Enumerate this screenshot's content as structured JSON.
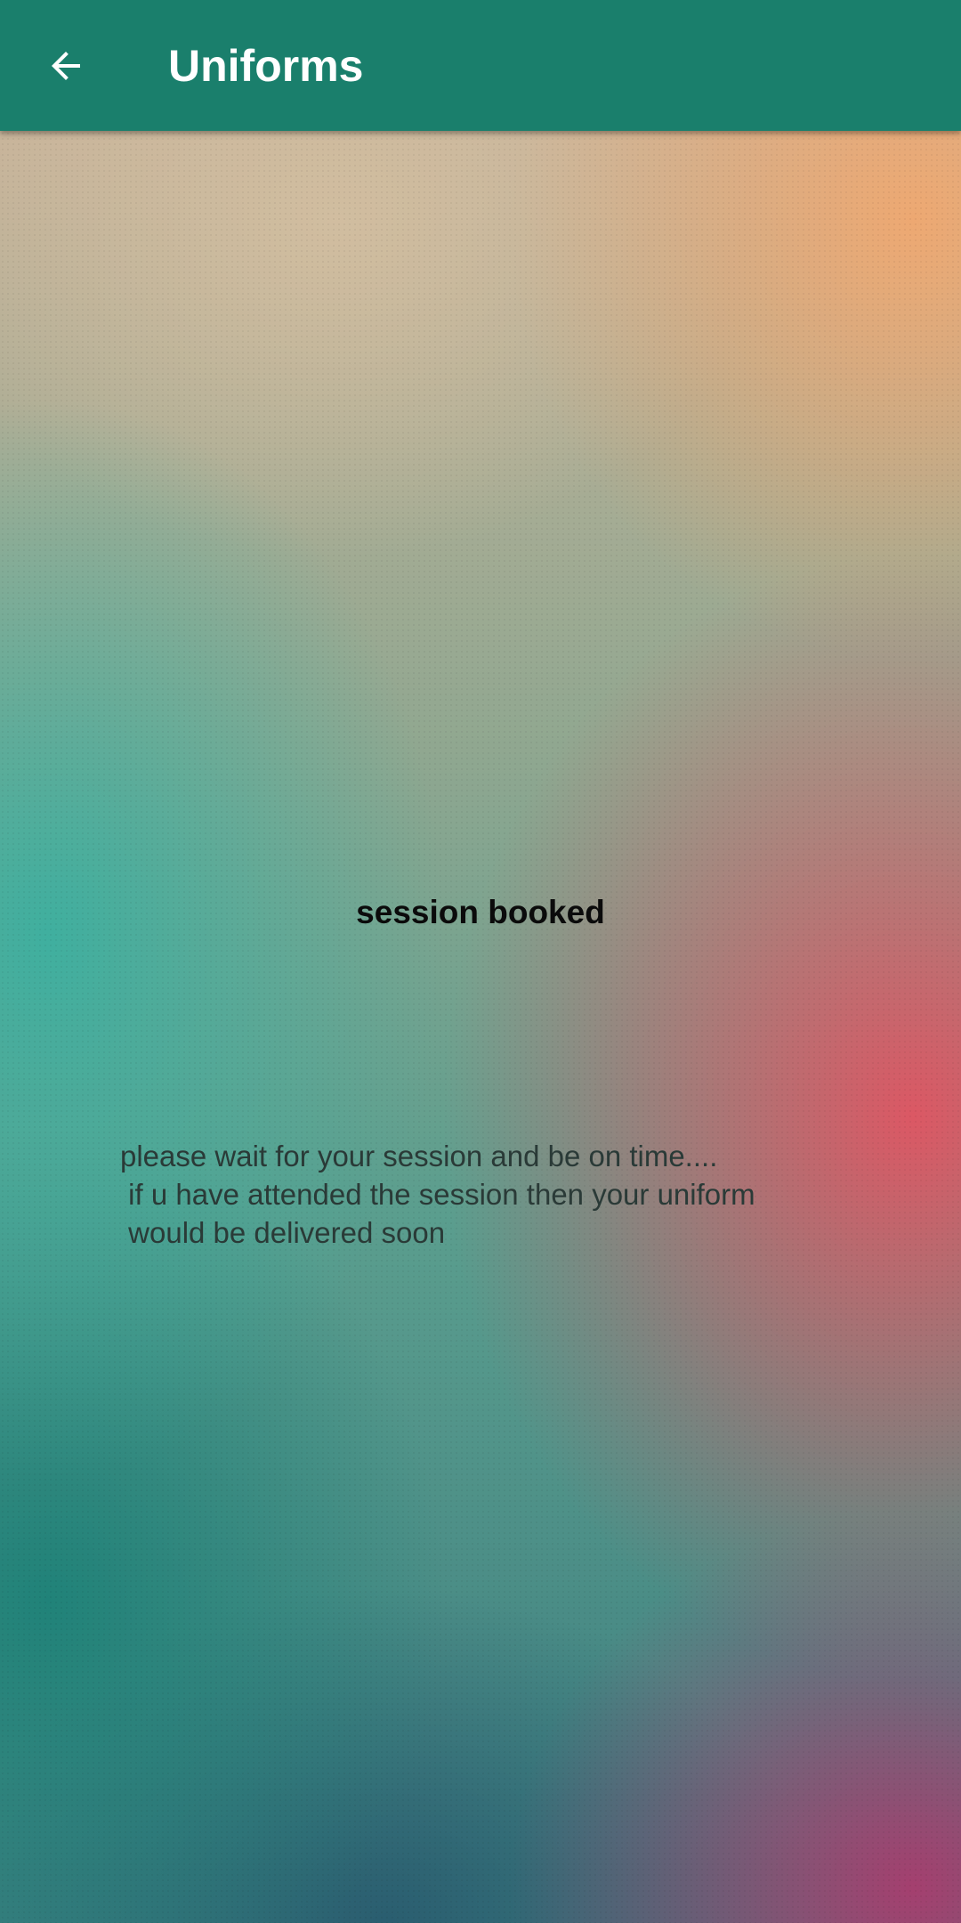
{
  "app_bar": {
    "title": "Uniforms",
    "back_icon": "arrow-left-icon",
    "background_color": "#1a7f6c",
    "title_color": "#ffffff"
  },
  "content": {
    "title": "session booked",
    "message": "please wait for your session and be on time....\n if u have attended the session then your uniform\n would be delivered soon"
  }
}
